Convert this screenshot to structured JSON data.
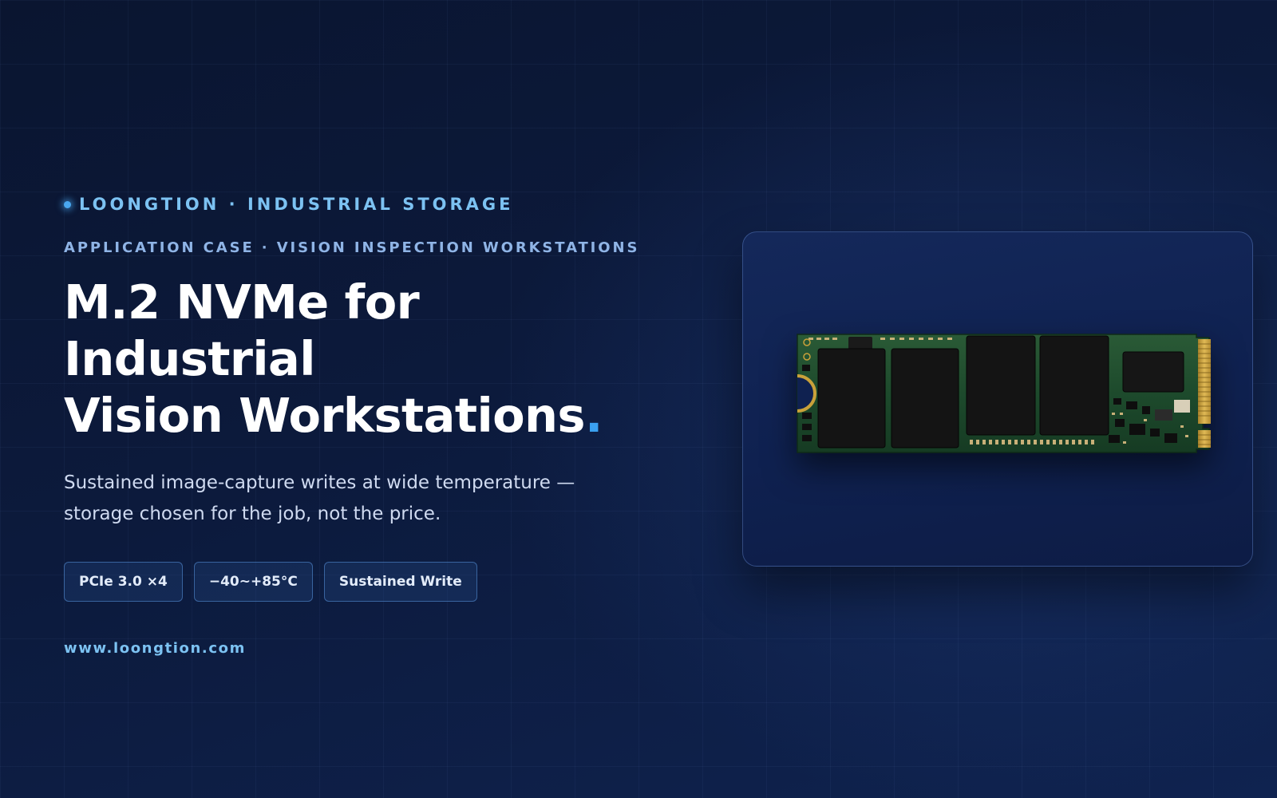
{
  "brand": {
    "name": "LOONGTION · INDUSTRIAL STORAGE"
  },
  "eyebrow": "APPLICATION CASE · VISION INSPECTION WORKSTATIONS",
  "headline": {
    "line1": "M.2 NVMe for Industrial",
    "line2": "Vision Workstations",
    "accent_mark": "."
  },
  "lede": {
    "line1": "Sustained image-capture writes at wide temperature —",
    "line2": "storage chosen for the job, not the price."
  },
  "chips": [
    {
      "label": "PCIe 3.0 ×4"
    },
    {
      "label": "−40~+85°C"
    },
    {
      "label": "Sustained Write"
    }
  ],
  "website": "www.loongtion.com",
  "colors": {
    "accent": "#3aa0f0",
    "brand_text": "#7cc2f2",
    "background": "#0c1a3c",
    "pcb": "#1d4a2c",
    "gold": "#c9a13a"
  }
}
